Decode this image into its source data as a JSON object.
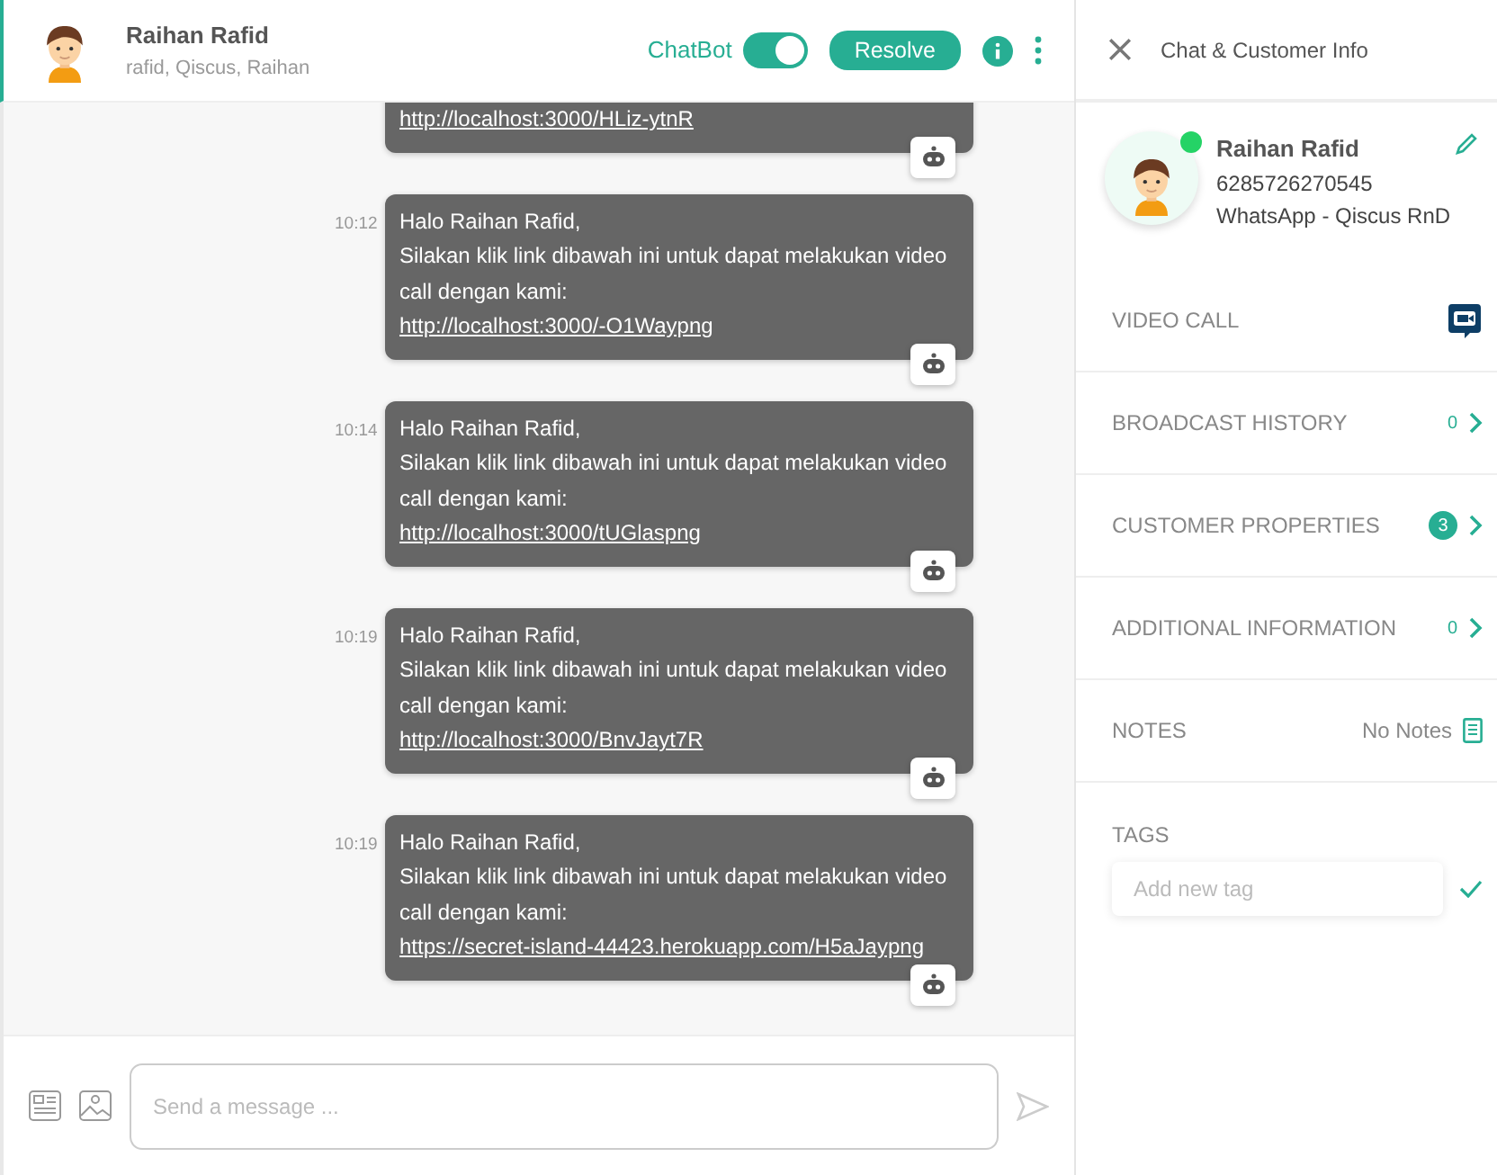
{
  "chat_header": {
    "name": "Raihan Rafid",
    "participants": "rafid, Qiscus, Raihan",
    "chatbot_label": "ChatBot",
    "chatbot_on": true,
    "resolve_button": "Resolve"
  },
  "messages": [
    {
      "link": "http://localhost:3000/HLiz-ytnR"
    },
    {
      "time": "10:12",
      "lines": [
        "Halo Raihan Rafid,",
        "Silakan klik link dibawah ini untuk dapat melakukan video call dengan kami:"
      ],
      "link": "http://localhost:3000/-O1Waypng"
    },
    {
      "time": "10:14",
      "lines": [
        "Halo Raihan Rafid,",
        "Silakan klik link dibawah ini untuk dapat melakukan video call dengan kami:"
      ],
      "link": "http://localhost:3000/tUGlaspng"
    },
    {
      "time": "10:19",
      "lines": [
        "Halo Raihan Rafid,",
        "Silakan klik link dibawah ini untuk dapat melakukan video call dengan kami:"
      ],
      "link": "http://localhost:3000/BnvJayt7R"
    },
    {
      "time": "10:19",
      "lines": [
        "Halo Raihan Rafid,",
        "Silakan klik link dibawah ini untuk dapat melakukan video call dengan kami:"
      ],
      "link": "https://secret-island-44423.herokuapp.com/H5aJaypng"
    }
  ],
  "composer": {
    "placeholder": "Send a message ..."
  },
  "info_panel": {
    "title": "Chat & Customer Info",
    "customer": {
      "name": "Raihan Rafid",
      "phone": "6285726270545",
      "channel": "WhatsApp - Qiscus RnD"
    },
    "sections": [
      {
        "kind": "video",
        "label": "VIDEO CALL"
      },
      {
        "kind": "count",
        "label": "BROADCAST HISTORY",
        "count": "0",
        "highlight": false
      },
      {
        "kind": "count",
        "label": "CUSTOMER PROPERTIES",
        "count": "3",
        "highlight": true
      },
      {
        "kind": "count",
        "label": "ADDITIONAL INFORMATION",
        "count": "0",
        "highlight": false
      },
      {
        "kind": "notes",
        "label": "NOTES",
        "value": "No Notes"
      }
    ],
    "tags": {
      "label": "TAGS",
      "placeholder": "Add new tag"
    }
  }
}
